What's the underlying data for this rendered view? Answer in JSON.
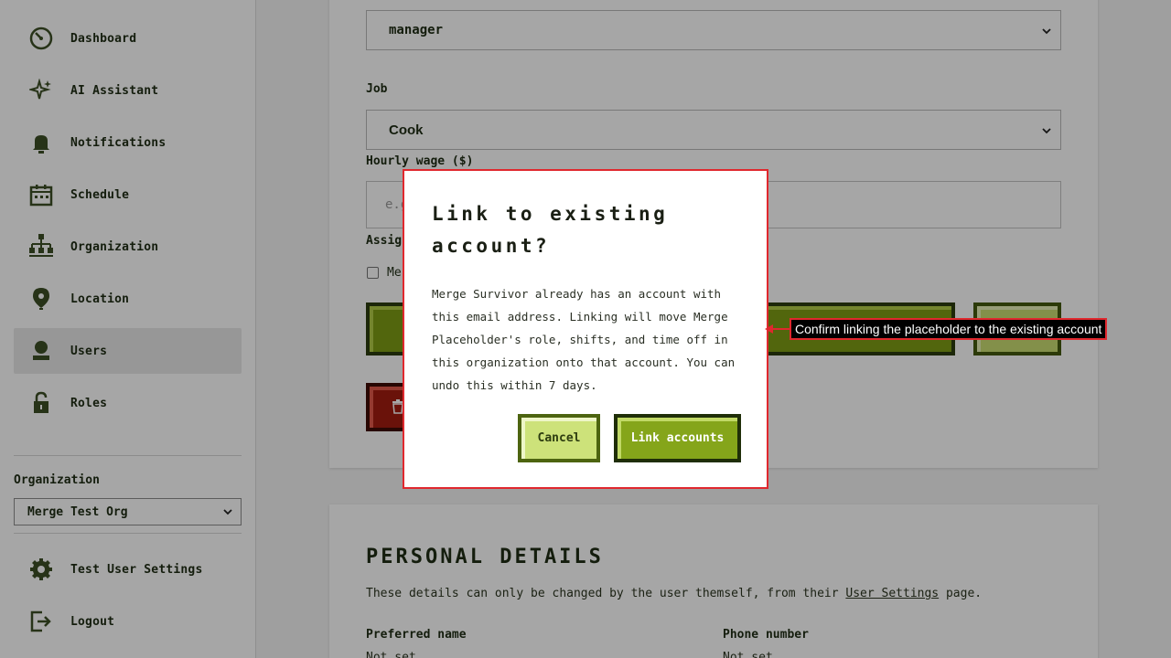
{
  "sidebar": {
    "items": [
      {
        "label": "Dashboard",
        "icon": "dashboard-icon"
      },
      {
        "label": "AI Assistant",
        "icon": "sparkle-icon"
      },
      {
        "label": "Notifications",
        "icon": "bell-icon"
      },
      {
        "label": "Schedule",
        "icon": "calendar-icon"
      },
      {
        "label": "Organization",
        "icon": "org-chart-icon"
      },
      {
        "label": "Location",
        "icon": "location-pin-icon"
      },
      {
        "label": "Users",
        "icon": "user-icon"
      },
      {
        "label": "Roles",
        "icon": "lock-icon"
      }
    ],
    "active_item": "Users",
    "org_label": "Organization",
    "org_value": "Merge Test Org",
    "bottom_items": [
      {
        "label": "Test User Settings",
        "icon": "gear-icon"
      },
      {
        "label": "Logout",
        "icon": "logout-icon"
      }
    ]
  },
  "form": {
    "role_value": "manager",
    "job_label": "Job",
    "job_value": "Cook",
    "wage_label": "Hourly wage ($)",
    "wage_placeholder": "e.g.",
    "assign_label": "Assig",
    "checkbox_label": "Me"
  },
  "personal": {
    "title": "Personal Details",
    "desc_pre": "These details can only be changed by the user themself, from their ",
    "desc_link": "User Settings",
    "desc_post": " page.",
    "preferred_name_label": "Preferred name",
    "preferred_name_value": "Not set",
    "phone_label": "Phone number",
    "phone_value": "Not set"
  },
  "modal": {
    "title": "Link to existing account?",
    "body": "Merge Survivor already has an account with this email address. Linking will move Merge Placeholder's role, shifts, and time off in this organization onto that account. You can undo this within 7 days.",
    "cancel_label": "Cancel",
    "confirm_label": "Link accounts"
  },
  "annotation": {
    "text": "Confirm linking the placeholder to the existing account"
  },
  "colors": {
    "accent_green": "#85a51a",
    "dark_green": "#1f2e08",
    "light_green": "#cde27a",
    "danger_red": "#a41c10",
    "annotation_red": "#e0282e"
  }
}
